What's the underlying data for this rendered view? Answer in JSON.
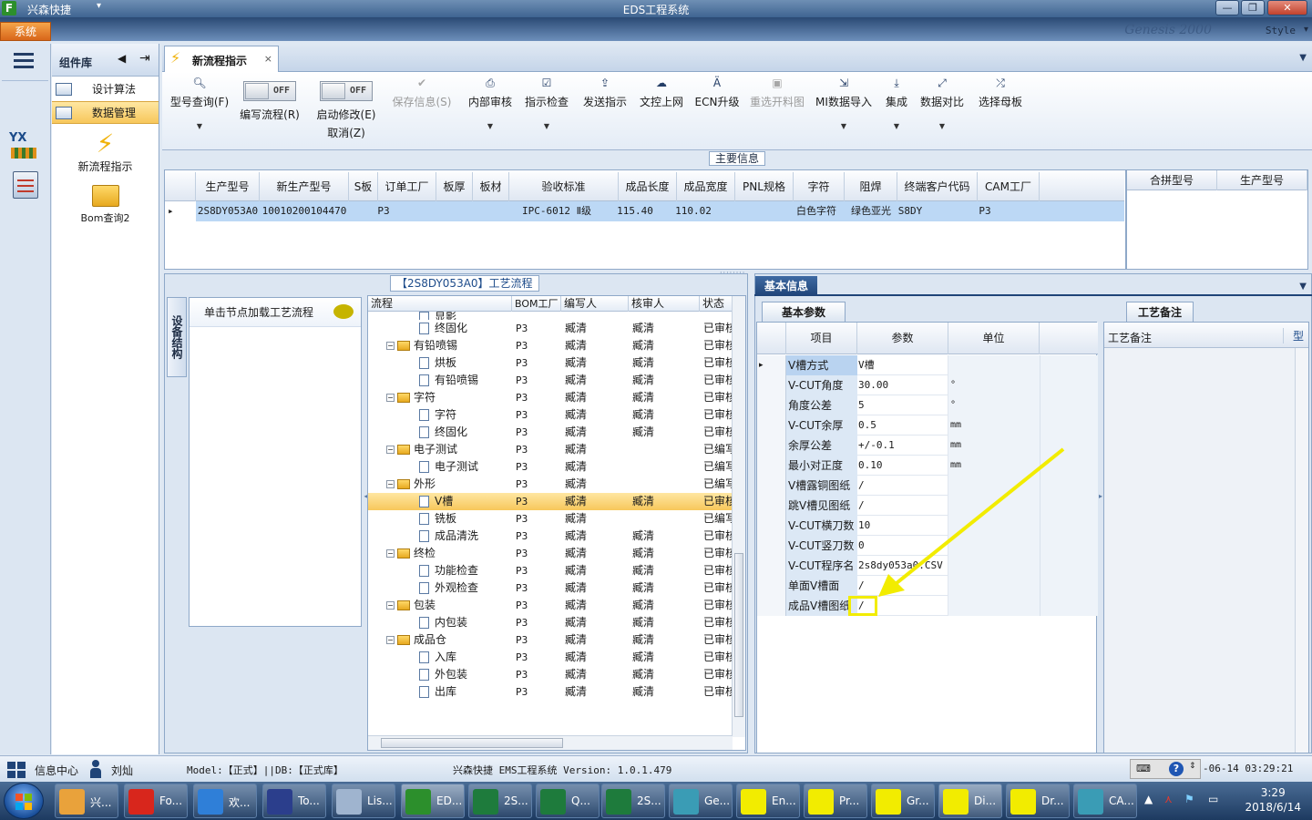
{
  "window": {
    "app_name": "兴森快捷",
    "title": "EDS工程系统",
    "min": "—",
    "max": "❐",
    "close": "✕"
  },
  "ribbon": {
    "system_tab": "系统",
    "style_label": "Style",
    "banner": "Genesis 2000"
  },
  "sidebar": {
    "header": "组件库",
    "items": [
      {
        "label": "设计算法"
      },
      {
        "label": "数据管理"
      }
    ],
    "tools": [
      {
        "label": "新流程指示"
      },
      {
        "label": "Bom查询2"
      }
    ],
    "nav_yx": "YX"
  },
  "doc_tab": {
    "label": "新流程指示",
    "close": "×"
  },
  "toolbar": {
    "model_query": "型号查询(F)",
    "edit_flow": "编写流程(R)",
    "edit_toggle": "OFF",
    "start_modify": "启动修改(E)",
    "start_toggle": "OFF",
    "cancel": "取消(Z)",
    "save_info": "保存信息(S)",
    "internal_review": "内部审核",
    "instruction_check": "指示检查",
    "send_instruction": "发送指示",
    "doc_upload": "文控上网",
    "ecn_upgrade": "ECN升级",
    "reselect_drawing": "重选开料图",
    "mi_import": "MI数据导入",
    "integrate": "集成",
    "data_compare": "数据对比",
    "select_master": "选择母板"
  },
  "main_info": {
    "title": "主要信息",
    "columns": [
      "生产型号",
      "新生产型号",
      "S板",
      "订单工厂",
      "板厚",
      "板材",
      "验收标准",
      "成品长度",
      "成品宽度",
      "PNL规格",
      "字符",
      "阻焊",
      "终端客户代码",
      "CAM工厂"
    ],
    "row": [
      "2S8DY053A0",
      "10010200104470",
      "",
      "P3",
      "",
      "",
      "IPC-6012 Ⅱ级",
      "115.40",
      "110.02",
      "",
      "白色字符",
      "绿色亚光",
      "S8DY",
      "P3"
    ],
    "side_columns": [
      "合拼型号",
      "生产型号"
    ]
  },
  "process": {
    "title": "【2S8DY053A0】工艺流程",
    "vertical_tab": "设备结构",
    "load_hint": "单击节点加载工艺流程",
    "columns": [
      "流程",
      "BOM工厂",
      "编写人",
      "核审人",
      "状态"
    ],
    "rows": [
      {
        "name": "显影",
        "level": 2,
        "type": "doc",
        "bom": "P3",
        "writer": "臧清",
        "reviewer": "臧清",
        "status": "已审核"
      },
      {
        "name": "终固化",
        "level": 2,
        "type": "doc",
        "bom": "P3",
        "writer": "臧清",
        "reviewer": "臧清",
        "status": "已审核"
      },
      {
        "name": "有铅喷锡",
        "level": 1,
        "type": "folder",
        "bom": "P3",
        "writer": "臧清",
        "reviewer": "臧清",
        "status": "已审核"
      },
      {
        "name": "烘板",
        "level": 2,
        "type": "doc",
        "bom": "P3",
        "writer": "臧清",
        "reviewer": "臧清",
        "status": "已审核"
      },
      {
        "name": "有铅喷锡",
        "level": 2,
        "type": "doc",
        "bom": "P3",
        "writer": "臧清",
        "reviewer": "臧清",
        "status": "已审核"
      },
      {
        "name": "字符",
        "level": 1,
        "type": "folder",
        "bom": "P3",
        "writer": "臧清",
        "reviewer": "臧清",
        "status": "已审核"
      },
      {
        "name": "字符",
        "level": 2,
        "type": "doc",
        "bom": "P3",
        "writer": "臧清",
        "reviewer": "臧清",
        "status": "已审核"
      },
      {
        "name": "终固化",
        "level": 2,
        "type": "doc",
        "bom": "P3",
        "writer": "臧清",
        "reviewer": "臧清",
        "status": "已审核"
      },
      {
        "name": "电子测试",
        "level": 1,
        "type": "folder",
        "bom": "P3",
        "writer": "臧清",
        "reviewer": "",
        "status": "已编写"
      },
      {
        "name": "电子测试",
        "level": 2,
        "type": "doc",
        "bom": "P3",
        "writer": "臧清",
        "reviewer": "",
        "status": "已编写"
      },
      {
        "name": "外形",
        "level": 1,
        "type": "folder",
        "bom": "P3",
        "writer": "臧清",
        "reviewer": "",
        "status": "已编写"
      },
      {
        "name": "V槽",
        "level": 2,
        "type": "doc",
        "bom": "P3",
        "writer": "臧清",
        "reviewer": "臧清",
        "status": "已审核",
        "selected": true
      },
      {
        "name": "铣板",
        "level": 2,
        "type": "doc",
        "bom": "P3",
        "writer": "臧清",
        "reviewer": "",
        "status": "已编写"
      },
      {
        "name": "成品清洗",
        "level": 2,
        "type": "doc",
        "bom": "P3",
        "writer": "臧清",
        "reviewer": "臧清",
        "status": "已审核"
      },
      {
        "name": "终检",
        "level": 1,
        "type": "folder",
        "bom": "P3",
        "writer": "臧清",
        "reviewer": "臧清",
        "status": "已审核"
      },
      {
        "name": "功能检查",
        "level": 2,
        "type": "doc",
        "bom": "P3",
        "writer": "臧清",
        "reviewer": "臧清",
        "status": "已审核"
      },
      {
        "name": "外观检查",
        "level": 2,
        "type": "doc",
        "bom": "P3",
        "writer": "臧清",
        "reviewer": "臧清",
        "status": "已审核"
      },
      {
        "name": "包装",
        "level": 1,
        "type": "folder",
        "bom": "P3",
        "writer": "臧清",
        "reviewer": "臧清",
        "status": "已审核"
      },
      {
        "name": "内包装",
        "level": 2,
        "type": "doc",
        "bom": "P3",
        "writer": "臧清",
        "reviewer": "臧清",
        "status": "已审核"
      },
      {
        "name": "成品仓",
        "level": 1,
        "type": "folder",
        "bom": "P3",
        "writer": "臧清",
        "reviewer": "臧清",
        "status": "已审核"
      },
      {
        "name": "入库",
        "level": 2,
        "type": "doc",
        "bom": "P3",
        "writer": "臧清",
        "reviewer": "臧清",
        "status": "已审核"
      },
      {
        "name": "外包装",
        "level": 2,
        "type": "doc",
        "bom": "P3",
        "writer": "臧清",
        "reviewer": "臧清",
        "status": "已审核"
      },
      {
        "name": "出库",
        "level": 2,
        "type": "doc",
        "bom": "P3",
        "writer": "臧清",
        "reviewer": "臧清",
        "status": "已审核"
      }
    ]
  },
  "basic_info": {
    "tab": "基本信息",
    "sub_tab": "基本参数",
    "notes_tab": "工艺备注",
    "notes_col1": "工艺备注",
    "notes_col2": "型",
    "columns": [
      "项目",
      "参数",
      "单位"
    ],
    "rows": [
      {
        "item": "V槽方式",
        "value": "V槽",
        "unit": ""
      },
      {
        "item": "V-CUT角度",
        "value": "30.00",
        "unit": "°"
      },
      {
        "item": "角度公差",
        "value": "5",
        "unit": "°"
      },
      {
        "item": "V-CUT余厚",
        "value": "0.5",
        "unit": "mm"
      },
      {
        "item": "余厚公差",
        "value": "+/-0.1",
        "unit": "mm"
      },
      {
        "item": "最小对正度",
        "value": "0.10",
        "unit": "mm"
      },
      {
        "item": "V槽露铜图纸",
        "value": "/",
        "unit": ""
      },
      {
        "item": "跳V槽见图纸",
        "value": "/",
        "unit": ""
      },
      {
        "item": "V-CUT横刀数",
        "value": "10",
        "unit": ""
      },
      {
        "item": "V-CUT竖刀数",
        "value": "0",
        "unit": ""
      },
      {
        "item": "V-CUT程序名",
        "value": "2s8dy053a0.CSV",
        "unit": ""
      },
      {
        "item": "单面V槽面",
        "value": "/",
        "unit": ""
      },
      {
        "item": "成品V槽图纸",
        "value": "/",
        "unit": ""
      }
    ]
  },
  "statusbar": {
    "info_center": "信息中心",
    "user": "刘灿",
    "model": "Model:【正式】||DB:【正式库】",
    "version": "兴森快捷 EMS工程系统 Version: 1.0.1.479",
    "datetime": "-06-14 03:29:21"
  },
  "taskbar": {
    "buttons": [
      {
        "label": "兴...",
        "color": "#e9a23b"
      },
      {
        "label": "Fo...",
        "color": "#d8261c"
      },
      {
        "label": "欢...",
        "color": "#2f7fd8"
      },
      {
        "label": "To...",
        "color": "#2b3e8c"
      },
      {
        "label": "Lis...",
        "color": "#9fb4cf"
      },
      {
        "label": "ED...",
        "color": "#2c8f2c",
        "active": true
      },
      {
        "label": "2S...",
        "color": "#1e7b3c"
      },
      {
        "label": "Q...",
        "color": "#1e7b3c"
      },
      {
        "label": "2S...",
        "color": "#1e7b3c"
      },
      {
        "label": "Ge...",
        "color": "#3a9cb5"
      },
      {
        "label": "En...",
        "color": "#f2ec00"
      },
      {
        "label": "Pr...",
        "color": "#f2ec00"
      },
      {
        "label": "Gr...",
        "color": "#f2ec00"
      },
      {
        "label": "Di...",
        "color": "#f2ec00",
        "active": true
      },
      {
        "label": "Dr...",
        "color": "#f2ec00"
      },
      {
        "label": "CA...",
        "color": "#3a9cb5"
      }
    ],
    "time": "3:29",
    "date": "2018/6/14"
  }
}
